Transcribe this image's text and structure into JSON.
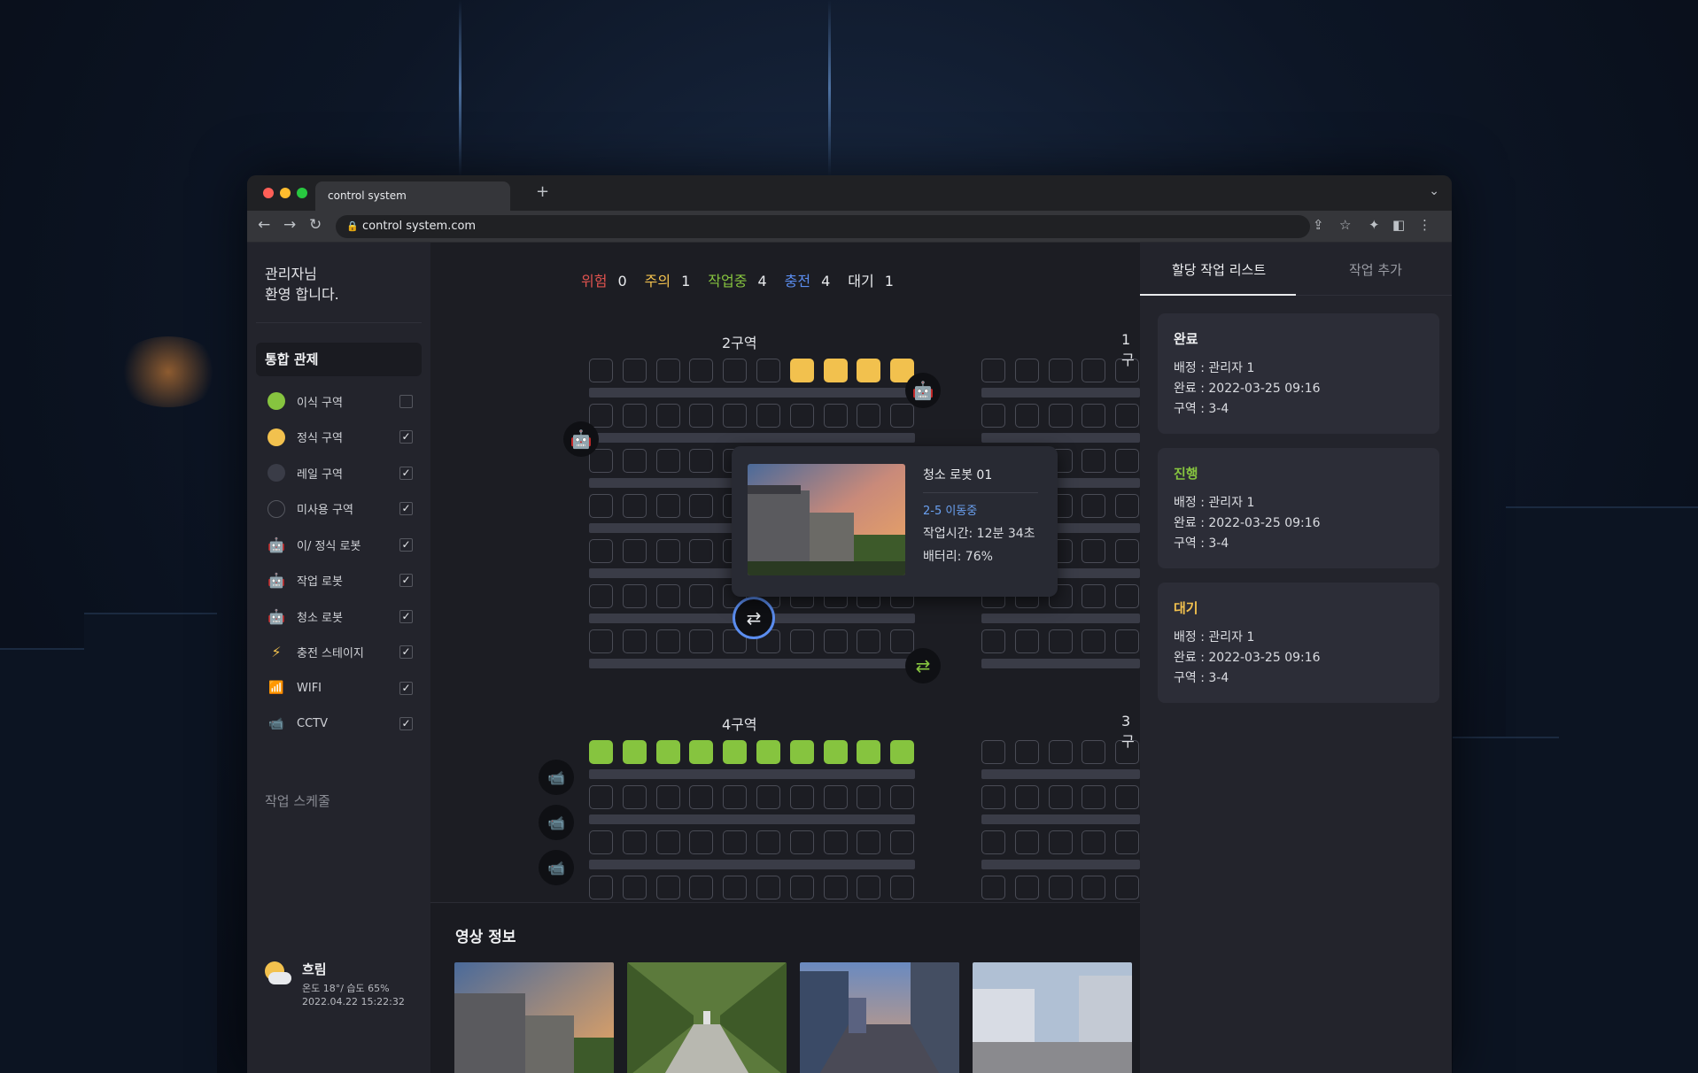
{
  "browser": {
    "tab_title": "control system",
    "url": "control system.com"
  },
  "sidebar": {
    "welcome_line1": "관리자님",
    "welcome_line2": "환영 합니다.",
    "section_title": "통합 관제",
    "legend": [
      {
        "label": "이식 구역",
        "icon": "green-circle",
        "checked": false
      },
      {
        "label": "정식 구역",
        "icon": "yellow-circle",
        "checked": true
      },
      {
        "label": "레일 구역",
        "icon": "gray-circle",
        "checked": true
      },
      {
        "label": "미사용 구역",
        "icon": "empty-circle",
        "checked": true
      },
      {
        "label": "이/ 정식 로봇",
        "icon": "robot-green",
        "checked": true
      },
      {
        "label": "작업 로봇",
        "icon": "robot-orange",
        "checked": true
      },
      {
        "label": "청소 로봇",
        "icon": "robot-blue",
        "checked": true
      },
      {
        "label": "충전 스테이지",
        "icon": "lightning",
        "checked": true
      },
      {
        "label": "WIFI",
        "icon": "wifi",
        "checked": true
      },
      {
        "label": "CCTV",
        "icon": "cctv",
        "checked": true
      }
    ],
    "schedule_link": "작업 스케줄",
    "weather": {
      "condition": "흐림",
      "detail": "온도 18°/ 습도 65%",
      "datetime": "2022.04.22 15:22:32"
    }
  },
  "status_bar": {
    "danger_label": "위험",
    "danger_count": "0",
    "caution_label": "주의",
    "caution_count": "1",
    "working_label": "작업중",
    "working_count": "4",
    "charging_label": "충전",
    "charging_count": "4",
    "standby_label": "대기",
    "standby_count": "1",
    "colors": {
      "danger": "#e0534f",
      "caution": "#f2c14e",
      "working": "#86c43f",
      "charging": "#5b8def",
      "standby": "#e8eaed"
    }
  },
  "zones": {
    "zone2": "2구역",
    "zone1": "1구",
    "zone4": "4구역",
    "zone3": "3구"
  },
  "popup": {
    "title": "청소 로봇 01",
    "state": "2-5 이동중",
    "work_time": "작업시간: 12분 34초",
    "battery": "배터리: 76%"
  },
  "video": {
    "title": "영상 정보"
  },
  "right_panel": {
    "tab_active": "할당 작업 리스트",
    "tab_add": "작업 추가",
    "cards": [
      {
        "status": "완료",
        "status_color": "#f0f1f3",
        "assign": "배정 : 관리자 1",
        "done": "완료 : 2022-03-25 09:16",
        "area": "구역 : 3-4"
      },
      {
        "status": "진행",
        "status_color": "#86c43f",
        "assign": "배정 : 관리자 1",
        "done": "완료 : 2022-03-25 09:16",
        "area": "구역 : 3-4"
      },
      {
        "status": "대기",
        "status_color": "#f2c14e",
        "assign": "배정 : 관리자 1",
        "done": "완료 : 2022-03-25 09:16",
        "area": "구역 : 3-4"
      }
    ]
  }
}
